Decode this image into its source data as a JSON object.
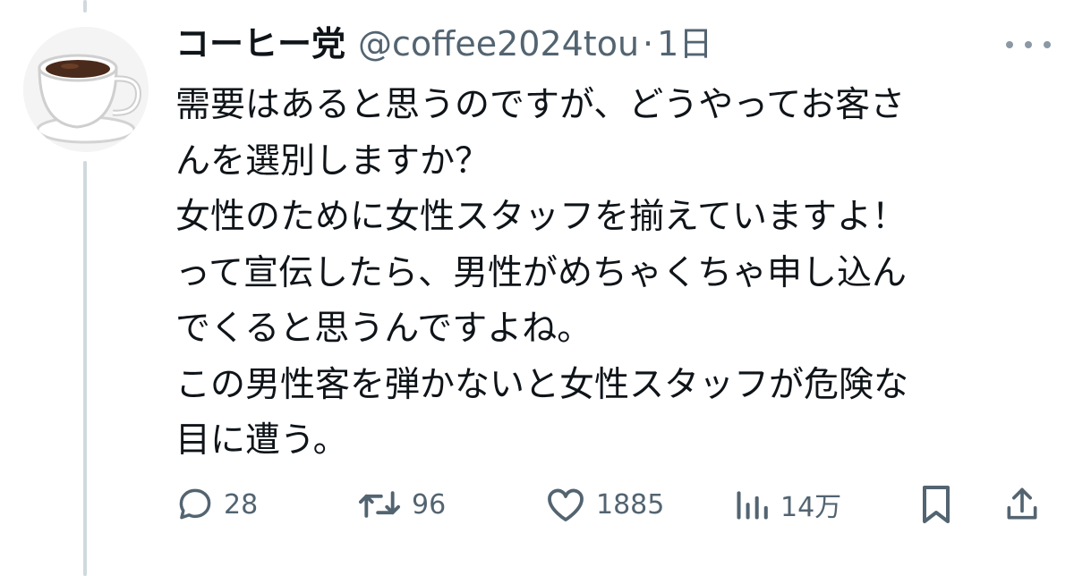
{
  "author": {
    "display_name": "コーヒー党",
    "handle": "@coffee2024tou",
    "separator": "·",
    "time": "1日",
    "avatar": "coffee-cup-avatar"
  },
  "menu": {
    "icon": "more-dots-icon"
  },
  "tweet": {
    "lines": [
      "需要はあると思うのですが、どうやってお客さ",
      "んを選別しますか？",
      "女性のために女性スタッフを揃えていますよ！",
      "って宣伝したら、男性がめちゃくちゃ申し込ん",
      "でくると思うんですよね。",
      "この男性客を弾かないと女性スタッフが危険な",
      "目に遭う。"
    ]
  },
  "actions": {
    "reply": {
      "icon": "reply-bubble-icon",
      "count": "28"
    },
    "retweet": {
      "icon": "retweet-icon",
      "count": "96"
    },
    "like": {
      "icon": "heart-icon",
      "count": "1885"
    },
    "views": {
      "icon": "views-bar-chart-icon",
      "count": "14万"
    },
    "bookmark": {
      "icon": "bookmark-icon"
    },
    "share": {
      "icon": "share-upload-icon"
    }
  },
  "colors": {
    "text": "#0f1419",
    "secondary": "#536471",
    "thread_line": "#cfd9de",
    "coffee": "#4a2a1a"
  }
}
